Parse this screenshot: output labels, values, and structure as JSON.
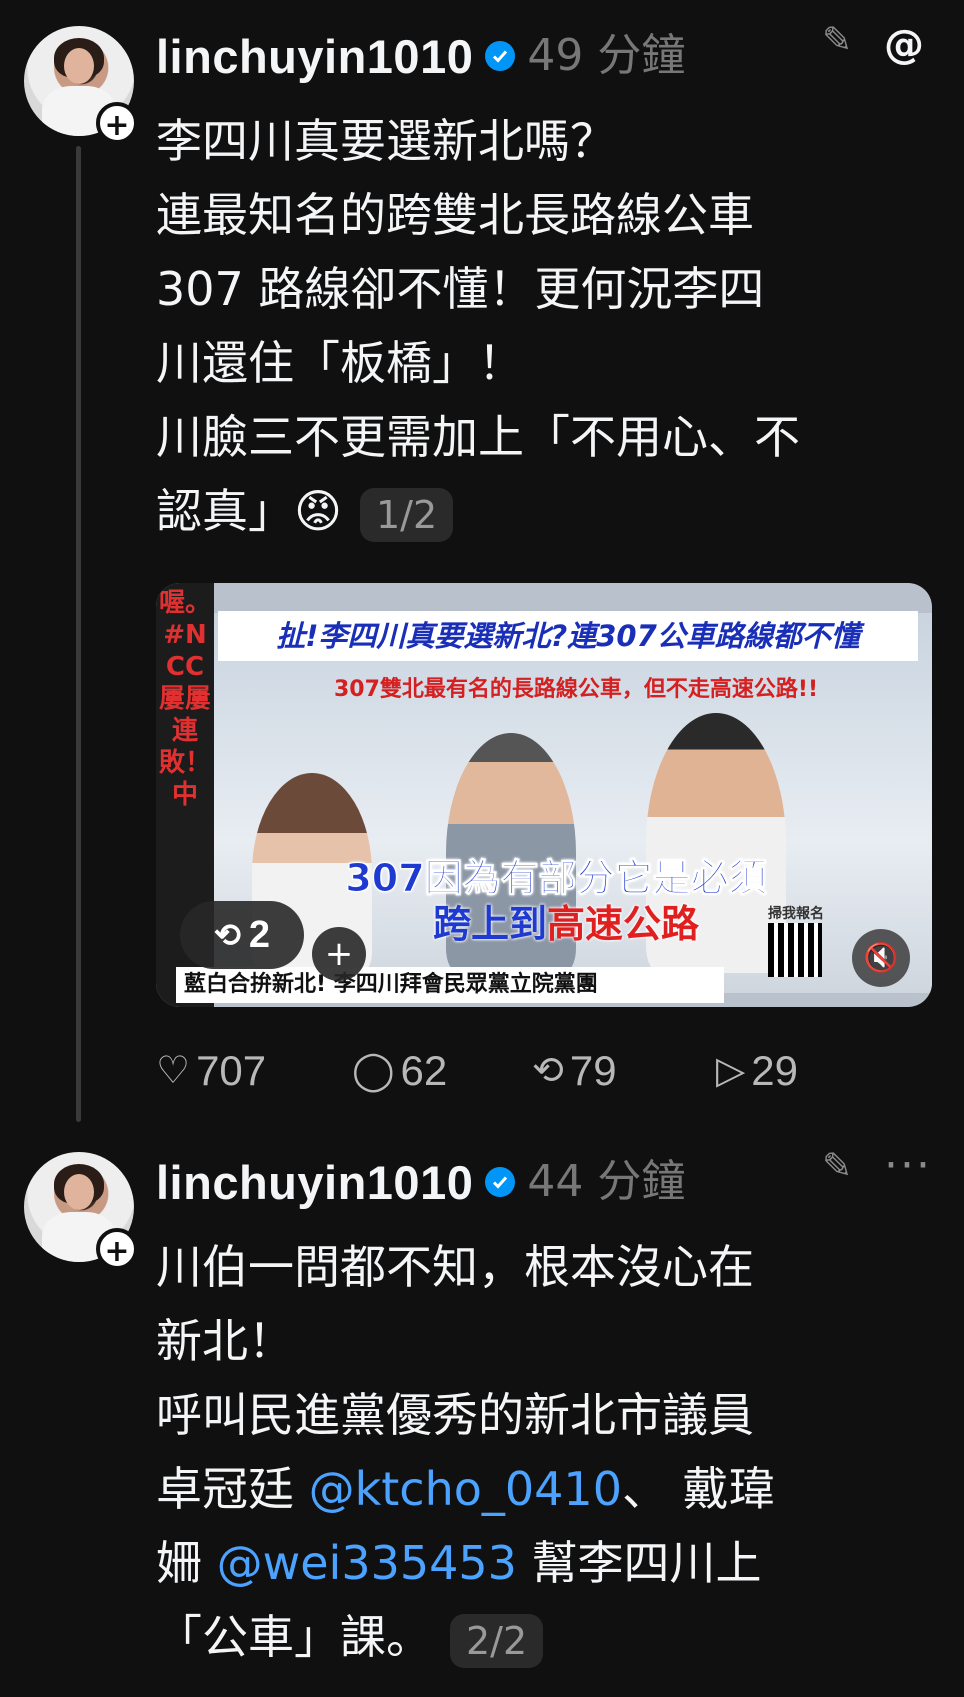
{
  "posts": [
    {
      "username": "linchuyin1010",
      "timestamp": "49 分鐘",
      "body": [
        "李四川真要選新北嗎？",
        "連最知名的跨雙北長路線公車",
        " 307 路線卻不懂！更何況李四",
        "川還住「板橋」！",
        "川臉三不更需加上「不用心、不",
        "認真」😡"
      ],
      "page_badge": "1/2",
      "media": {
        "side_text": "喔。#NCC屢屢連敗！中",
        "title_banner": "扯!李四川真要選新北?連307公車路線都不懂",
        "subtitle": "307雙北最有名的長路線公車，但不走高速公路!!",
        "caption_line1": "307因為有部分它是必須",
        "caption_line2a": "跨上到",
        "caption_line2b": "高速公路",
        "bottom_banner": "藍白合拚新北! 李四川拜會民眾黨立院黨團",
        "qr_label": "掃我報名",
        "repost_count": "2"
      },
      "stats": {
        "likes": "707",
        "comments": "62",
        "reposts": "79",
        "shares": "29"
      }
    },
    {
      "username": "linchuyin1010",
      "timestamp": "44 分鐘",
      "body_lines": [
        {
          "text": "川伯一問都不知，根本沒心在"
        },
        {
          "text": "新北！"
        },
        {
          "text": "呼叫民進黨優秀的新北市議員"
        },
        {
          "pre": "卓冠廷 ",
          "mention": "@ktcho_0410",
          "post": "、 戴瑋"
        },
        {
          "pre": "姍 ",
          "mention": "@wei335453",
          "post": " 幫李四川上"
        },
        {
          "text": "「公車」課。"
        }
      ],
      "page_badge": "2/2"
    }
  ],
  "icons": {
    "edit": "pencil-icon",
    "threads": "threads-logo-icon",
    "more": "more-icon",
    "like": "heart-icon",
    "comment": "comment-icon",
    "repost": "repost-icon",
    "share": "share-icon",
    "mute": "mute-icon",
    "follow": "plus-icon"
  },
  "colors": {
    "background": "#101010",
    "mention": "#4ca3ff",
    "verified": "#0095f6",
    "muted_text": "#777777"
  }
}
